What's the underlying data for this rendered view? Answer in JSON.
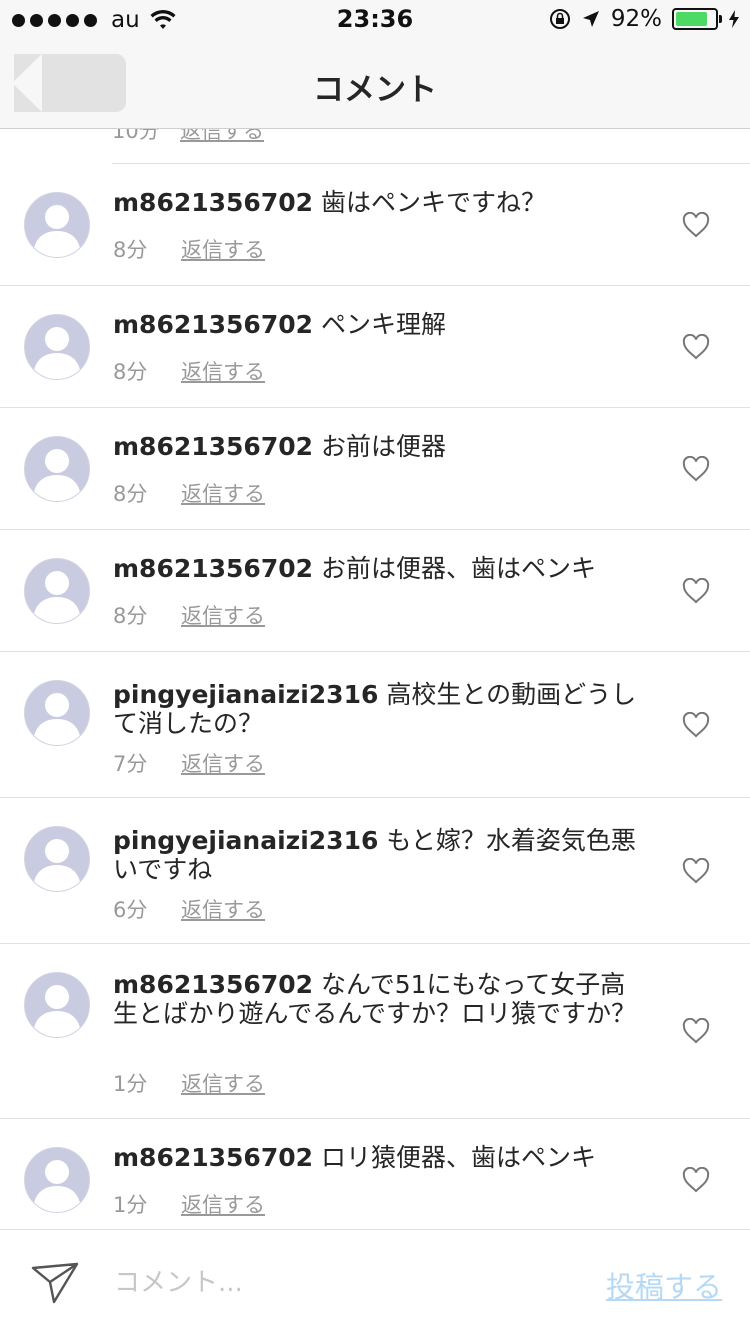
{
  "status_bar": {
    "carrier": "au",
    "time": "23:36",
    "battery": "92%",
    "battery_level": 0.92,
    "battery_color": "#4cd964"
  },
  "nav": {
    "title": "コメント",
    "back_icon": "back-arrow-icon"
  },
  "partial_item": {
    "time": "10分",
    "reply": "返信する"
  },
  "comments": [
    {
      "user": "m8621356702",
      "text": "歯はペンキですね？",
      "time": "8分",
      "reply": "返信する"
    },
    {
      "user": "m8621356702",
      "text": "ペンキ理解",
      "time": "8分",
      "reply": "返信する"
    },
    {
      "user": "m8621356702",
      "text": "お前は便器",
      "time": "8分",
      "reply": "返信する"
    },
    {
      "user": "m8621356702",
      "text": "お前は便器、歯はペンキ",
      "time": "8分",
      "reply": "返信する"
    },
    {
      "user": "pingyejianaizi2316",
      "text": "高校生との動画どうして消したの？",
      "time": "7分",
      "reply": "返信する"
    },
    {
      "user": "pingyejianaizi2316",
      "text": "もと嫁？水着姿気色悪いですね",
      "time": "6分",
      "reply": "返信する"
    },
    {
      "user": "m8621356702",
      "text": "なんで51にもなって女子高生とばかり遊んでるんですか？ロリ猿ですか？",
      "time": "1分",
      "reply": "返信する"
    },
    {
      "user": "m8621356702",
      "text": "ロリ猿便器、歯はペンキ",
      "time": "1分",
      "reply": "返信する"
    }
  ],
  "composer": {
    "placeholder": "コメント...",
    "post_label": "投稿する",
    "post_color": "#b5d9f5"
  }
}
